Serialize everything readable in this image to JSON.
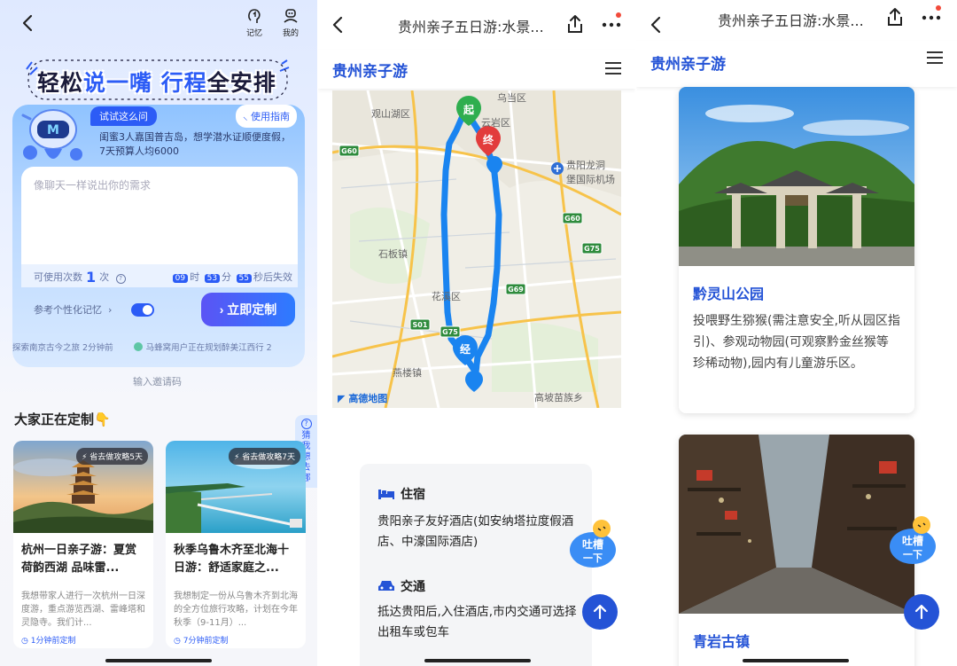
{
  "p1": {
    "top_icons": [
      {
        "label": "记忆",
        "icon": "memory-icon"
      },
      {
        "label": "我的",
        "icon": "profile-icon"
      }
    ],
    "banner_a": "轻松",
    "banner_b": "说一嘴",
    "banner_c": "行程",
    "banner_d": "全安排",
    "try_chip": "试试这么问",
    "guide_btn": "使用指南",
    "hint_text": "闺蜜3人嘉国普吉岛，想学潜水证顺便度假，7天预算人均6000",
    "input_placeholder": "像聊天一样说出你的需求",
    "quota_label": "可使用次数",
    "quota_count": "1",
    "quota_unit": "次",
    "timer_h": "09",
    "timer_h_unit": "时",
    "timer_m": "53",
    "timer_m_unit": "分",
    "timer_s": "55",
    "timer_s_unit": "秒后失效",
    "memory_label": "参考个性化记忆",
    "memory_enabled": true,
    "go_button": "立即定制",
    "ticker": [
      "探索南京古今之旅  2分钟前",
      "马蜂窝用户正在规划醉美江西行  2"
    ],
    "invite": "输入邀请码",
    "section_title": "大家正在定制👇",
    "guess_tab": "猜我想去哪",
    "cards": [
      {
        "badge": "省去做攻略5天",
        "title": "杭州一日亲子游：夏赏荷韵西湖 品味雷...",
        "desc": "我想带家人进行一次杭州一日深度游，重点游览西湖、雷峰塔和灵隐寺。我们计...",
        "time": "1分钟前定制"
      },
      {
        "badge": "省去做攻略7天",
        "title": "秋季乌鲁木齐至北海十日游：舒适家庭之...",
        "desc": "我想制定一份从乌鲁木齐到北海的全方位旅行攻略，计划在今年秋季（9-11月）...",
        "time": "7分钟前定制"
      }
    ]
  },
  "p2": {
    "nav_title": "贵州亲子五日游:水景...",
    "brand": "贵州亲子游",
    "map_labels": [
      "观山湖区",
      "乌当区",
      "云岩区",
      "贵阳龙洞",
      "堡国际机场",
      "石板镇",
      "花溪区",
      "燕楼镇",
      "高坡苗族乡"
    ],
    "road_labels": [
      "G60",
      "G60",
      "G75",
      "G69",
      "S01",
      "G75"
    ],
    "markers": {
      "start": "起",
      "end": "终",
      "via": "经"
    },
    "map_logo": "高德地图",
    "info": {
      "stay_title": "住宿",
      "stay_body": "贵阳亲子友好酒店(如安纳塔拉度假酒店、中濠国际酒店)",
      "traffic_title": "交通",
      "traffic_body": "抵达贵阳后,入住酒店,市内交通可选择出租车或包车"
    },
    "tucao_a": "吐槽",
    "tucao_b": "一下"
  },
  "p3": {
    "nav_title": "贵州亲子五日游:水景...",
    "brand": "贵州亲子游",
    "spots": [
      {
        "name": "黔灵山公园",
        "desc": "投喂野生猕猴(需注意安全,听从园区指引)、参观动物园(可观察黔金丝猴等珍稀动物),园内有儿童游乐区。"
      },
      {
        "name": "青岩古镇",
        "desc": ""
      }
    ],
    "tucao_a": "吐槽",
    "tucao_b": "一下"
  },
  "colors": {
    "accent": "#2c5cf6",
    "brand_blue": "#2453d6",
    "route": "#1a84f0",
    "notify": "#f24a3a"
  }
}
